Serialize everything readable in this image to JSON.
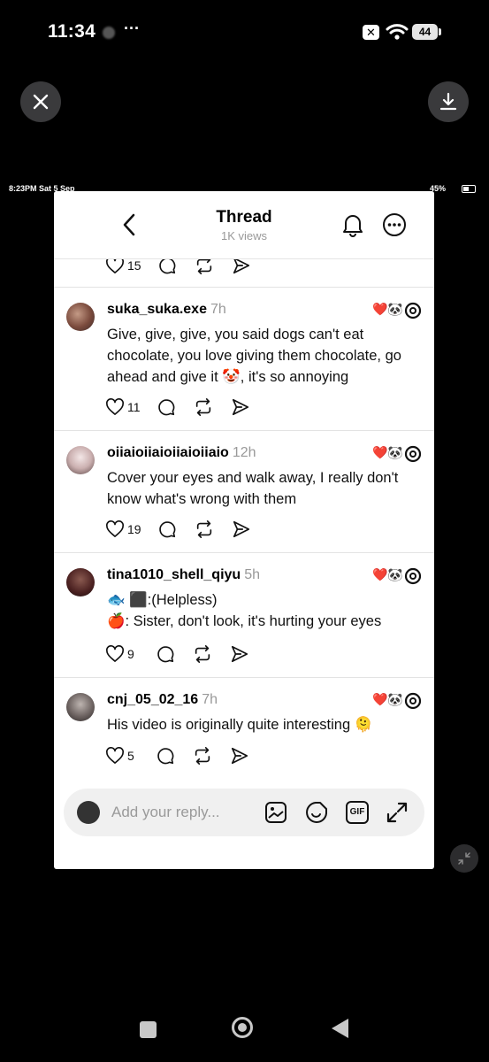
{
  "status_bar": {
    "time": "11:34",
    "more": "···",
    "battery": "44"
  },
  "inner_status": {
    "left": "8:23PM  Sat 5 Sep",
    "right": "45%"
  },
  "thread": {
    "title": "Thread",
    "views": "1K views"
  },
  "top_partial": {
    "likes": "15"
  },
  "comments": [
    {
      "username": "suka_suka.exe",
      "time": "7h",
      "text": "Give, give, give, you said dogs can't eat chocolate, you love giving them chocolate, go ahead and give it 🤡, it's so annoying",
      "likes": "11"
    },
    {
      "username": "oiiaioiiaioiiaioiiaio",
      "time": "12h",
      "text": "Cover your eyes and walk away, I really don't know what's wrong with them",
      "likes": "19"
    },
    {
      "username": "tina1010_shell_qiyu",
      "time": "5h",
      "line1": "🐟 ⬛:(Helpless)",
      "line2": "🍎: Sister, don't look, it's hurting your eyes",
      "likes": "9"
    },
    {
      "username": "cnj_05_02_16",
      "time": "7h",
      "text": "His video is originally quite interesting 🫠",
      "likes": "5"
    }
  ],
  "reply": {
    "placeholder": "Add your reply...",
    "gif_label": "GIF"
  },
  "icons": [
    "close-icon",
    "download-icon",
    "back-icon",
    "bell-icon",
    "more-icon",
    "heart-icon",
    "comment-icon",
    "repost-icon",
    "share-icon",
    "threads-logo-icon",
    "image-icon",
    "sticker-icon",
    "gif-icon",
    "expand-icon",
    "collapse-icon"
  ]
}
